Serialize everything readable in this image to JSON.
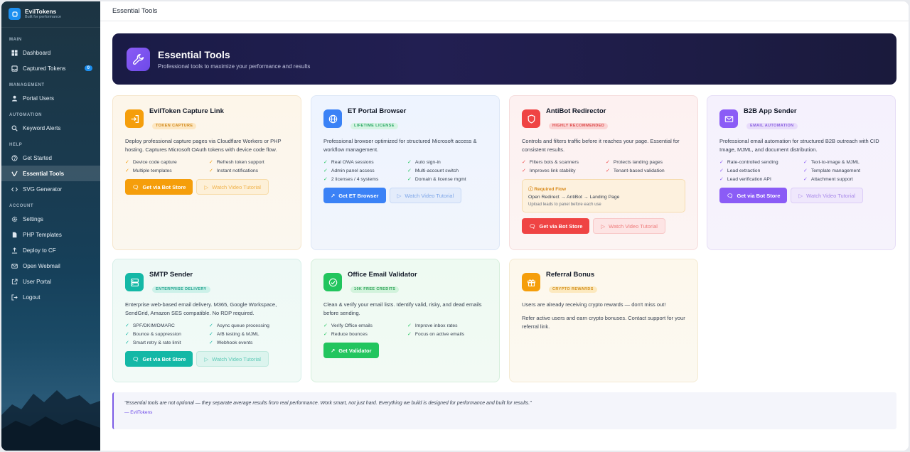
{
  "brand": {
    "name": "EvilTokens",
    "tagline": "Built for performance"
  },
  "sidebar": {
    "sections": {
      "main": "MAIN",
      "management": "MANAGEMENT",
      "automation": "AUTOMATION",
      "help": "HELP",
      "account": "ACCOUNT"
    },
    "items": {
      "dashboard": "Dashboard",
      "captured_tokens": "Captured Tokens",
      "captured_tokens_count": "0",
      "portal_users": "Portal Users",
      "keyword_alerts": "Keyword Alerts",
      "get_started": "Get Started",
      "essential_tools": "Essential Tools",
      "svg_generator": "SVG Generator",
      "settings": "Settings",
      "php_templates": "PHP Templates",
      "deploy_cf": "Deploy to CF",
      "open_webmail": "Open Webmail",
      "user_portal": "User Portal",
      "logout": "Logout"
    }
  },
  "topbar": {
    "title": "Essential Tools"
  },
  "hero": {
    "title": "Essential Tools",
    "subtitle": "Professional tools to maximize your performance and results"
  },
  "cards": {
    "capture": {
      "title": "EvilToken Capture Link",
      "pill": "TOKEN CAPTURE",
      "desc": "Deploy professional capture pages via Cloudflare Workers or PHP hosting. Captures Microsoft OAuth tokens with device code flow.",
      "f1": "Device code capture",
      "f2": "Refresh token support",
      "f3": "Multiple templates",
      "f4": "Instant notifications",
      "btn1": "Get via Bot Store",
      "btn2": "Watch Video Tutorial"
    },
    "portal": {
      "title": "ET Portal Browser",
      "pill": "LIFETIME LICENSE",
      "desc": "Professional browser optimized for structured Microsoft access & workflow management.",
      "f1": "Real OWA sessions",
      "f2": "Auto sign-in",
      "f3": "Admin panel access",
      "f4": "Multi-account switch",
      "f5": "2 licenses / 4 systems",
      "f6": "Domain & license mgmt",
      "btn1": "Get ET Browser",
      "btn2": "Watch Video Tutorial"
    },
    "antibot": {
      "title": "AntiBot Redirector",
      "pill": "HIGHLY RECOMMENDED",
      "desc": "Controls and filters traffic before it reaches your page. Essential for consistent results.",
      "f1": "Filters bots & scanners",
      "f2": "Protects landing pages",
      "f3": "Improves link stability",
      "f4": "Tenant-based validation",
      "flow_title": "Required Flow",
      "flow_route": "Open Redirect → AntiBot → Landing Page",
      "flow_note": "Upload leads to panel before each use",
      "btn1": "Get via Bot Store",
      "btn2": "Watch Video Tutorial"
    },
    "b2b": {
      "title": "B2B App Sender",
      "pill": "EMAIL AUTOMATION",
      "desc": "Professional email automation for structured B2B outreach with CID Image, MJML, and document distribution.",
      "f1": "Rate-controlled sending",
      "f2": "Text-to-image & MJML",
      "f3": "Lead extraction",
      "f4": "Template management",
      "f5": "Lead verification API",
      "f6": "Attachment support",
      "btn1": "Get via Bot Store",
      "btn2": "Watch Video Tutorial"
    },
    "smtp": {
      "title": "SMTP Sender",
      "pill": "ENTERPRISE DELIVERY",
      "desc": "Enterprise web-based email delivery. M365, Google Workspace, SendGrid, Amazon SES compatible. No RDP required.",
      "f1": "SPF/DKIM/DMARC",
      "f2": "Async queue processing",
      "f3": "Bounce & suppression",
      "f4": "A/B testing & MJML",
      "f5": "Smart retry & rate limit",
      "f6": "Webhook events",
      "btn1": "Get via Bot Store",
      "btn2": "Watch Video Tutorial"
    },
    "validator": {
      "title": "Office Email Validator",
      "pill": "10K FREE CREDITS",
      "desc": "Clean & verify your email lists. Identify valid, risky, and dead emails before sending.",
      "f1": "Verify Office emails",
      "f2": "Improve inbox rates",
      "f3": "Reduce bounces",
      "f4": "Focus on active emails",
      "btn1": "Get Validator"
    },
    "referral": {
      "title": "Referral Bonus",
      "pill": "CRYPTO REWARDS",
      "desc1": "Users are already receiving crypto rewards — don't miss out!",
      "desc2": "Refer active users and earn crypto bonuses. Contact support for your referral link."
    }
  },
  "quote": {
    "text": "\"Essential tools are not optional — they separate average results from real performance. Work smart, not just hard. Everything we build is designed for performance and built for results.\"",
    "author": "— EvilTokens"
  },
  "colors": {
    "orange": "#f59e0b",
    "blue": "#3b82f6",
    "red": "#ef4444",
    "purple": "#8b5cf6",
    "teal": "#14b8a6",
    "green": "#22c55e"
  }
}
